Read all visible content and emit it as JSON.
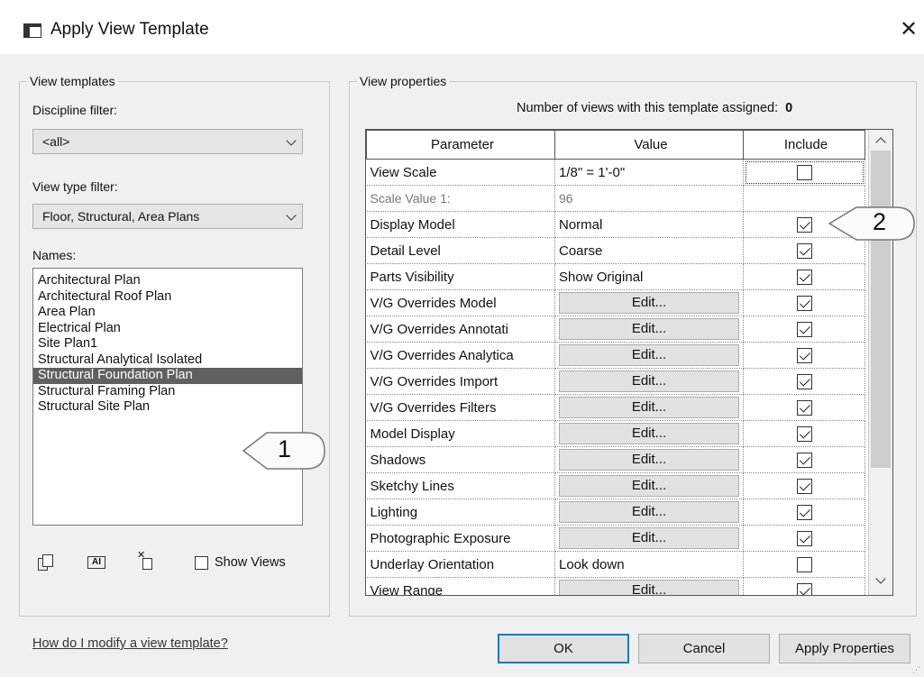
{
  "window": {
    "title": "Apply View Template",
    "icon": "view-template-icon",
    "close_glyph": "✕"
  },
  "left_group": {
    "legend": "View templates",
    "discipline_filter": {
      "label": "Discipline filter:",
      "value": "<all>"
    },
    "view_type_filter": {
      "label": "View type filter:",
      "value": "Floor, Structural, Area Plans"
    },
    "names_label": "Names:",
    "names": [
      "Architectural Plan",
      "Architectural Roof Plan",
      "Area Plan",
      "Electrical Plan",
      "Site Plan1",
      "Structural Analytical Isolated",
      "Structural Foundation Plan",
      "Structural Framing Plan",
      "Structural Site Plan"
    ],
    "selected_name": "Structural Foundation Plan",
    "tools": {
      "duplicate_icon": "duplicate-icon",
      "rename_icon": "rename-icon",
      "rename_glyph": "AI",
      "delete_icon": "delete-icon"
    },
    "show_views": {
      "label": "Show Views",
      "checked": false
    }
  },
  "right_group": {
    "legend": "View properties",
    "assigned": {
      "label": "Number of views with this template assigned:",
      "count": "0"
    },
    "columns": {
      "parameter": "Parameter",
      "value": "Value",
      "include": "Include"
    },
    "rows": [
      {
        "parameter": "View Scale",
        "value": "1/8\" = 1'-0\"",
        "kind": "text",
        "include": false
      },
      {
        "parameter": "Scale Value    1:",
        "value": "96",
        "kind": "dim",
        "include": null
      },
      {
        "parameter": "Display Model",
        "value": "Normal",
        "kind": "text",
        "include": true
      },
      {
        "parameter": "Detail Level",
        "value": "Coarse",
        "kind": "text",
        "include": true
      },
      {
        "parameter": "Parts Visibility",
        "value": "Show Original",
        "kind": "text",
        "include": true
      },
      {
        "parameter": "V/G Overrides Model",
        "value": "Edit...",
        "kind": "button",
        "include": true
      },
      {
        "parameter": "V/G Overrides Annotati",
        "value": "Edit...",
        "kind": "button",
        "include": true
      },
      {
        "parameter": "V/G Overrides Analytica",
        "value": "Edit...",
        "kind": "button",
        "include": true
      },
      {
        "parameter": "V/G Overrides Import",
        "value": "Edit...",
        "kind": "button",
        "include": true
      },
      {
        "parameter": "V/G Overrides Filters",
        "value": "Edit...",
        "kind": "button",
        "include": true
      },
      {
        "parameter": "Model Display",
        "value": "Edit...",
        "kind": "button",
        "include": true
      },
      {
        "parameter": "Shadows",
        "value": "Edit...",
        "kind": "button",
        "include": true
      },
      {
        "parameter": "Sketchy Lines",
        "value": "Edit...",
        "kind": "button",
        "include": true
      },
      {
        "parameter": "Lighting",
        "value": "Edit...",
        "kind": "button",
        "include": true
      },
      {
        "parameter": "Photographic Exposure",
        "value": "Edit...",
        "kind": "button",
        "include": true
      },
      {
        "parameter": "Underlay Orientation",
        "value": "Look down",
        "kind": "text",
        "include": false
      },
      {
        "parameter": "View Range",
        "value": "Edit...",
        "kind": "button",
        "include": true
      }
    ]
  },
  "callouts": {
    "one": "1",
    "two": "2"
  },
  "footer": {
    "help_link": "How do I modify a view template?",
    "ok": "OK",
    "cancel": "Cancel",
    "apply": "Apply Properties"
  },
  "colors": {
    "dialog_bg": "#f0f0f0",
    "selection_bg": "#606060",
    "ok_border": "#0078d7"
  }
}
